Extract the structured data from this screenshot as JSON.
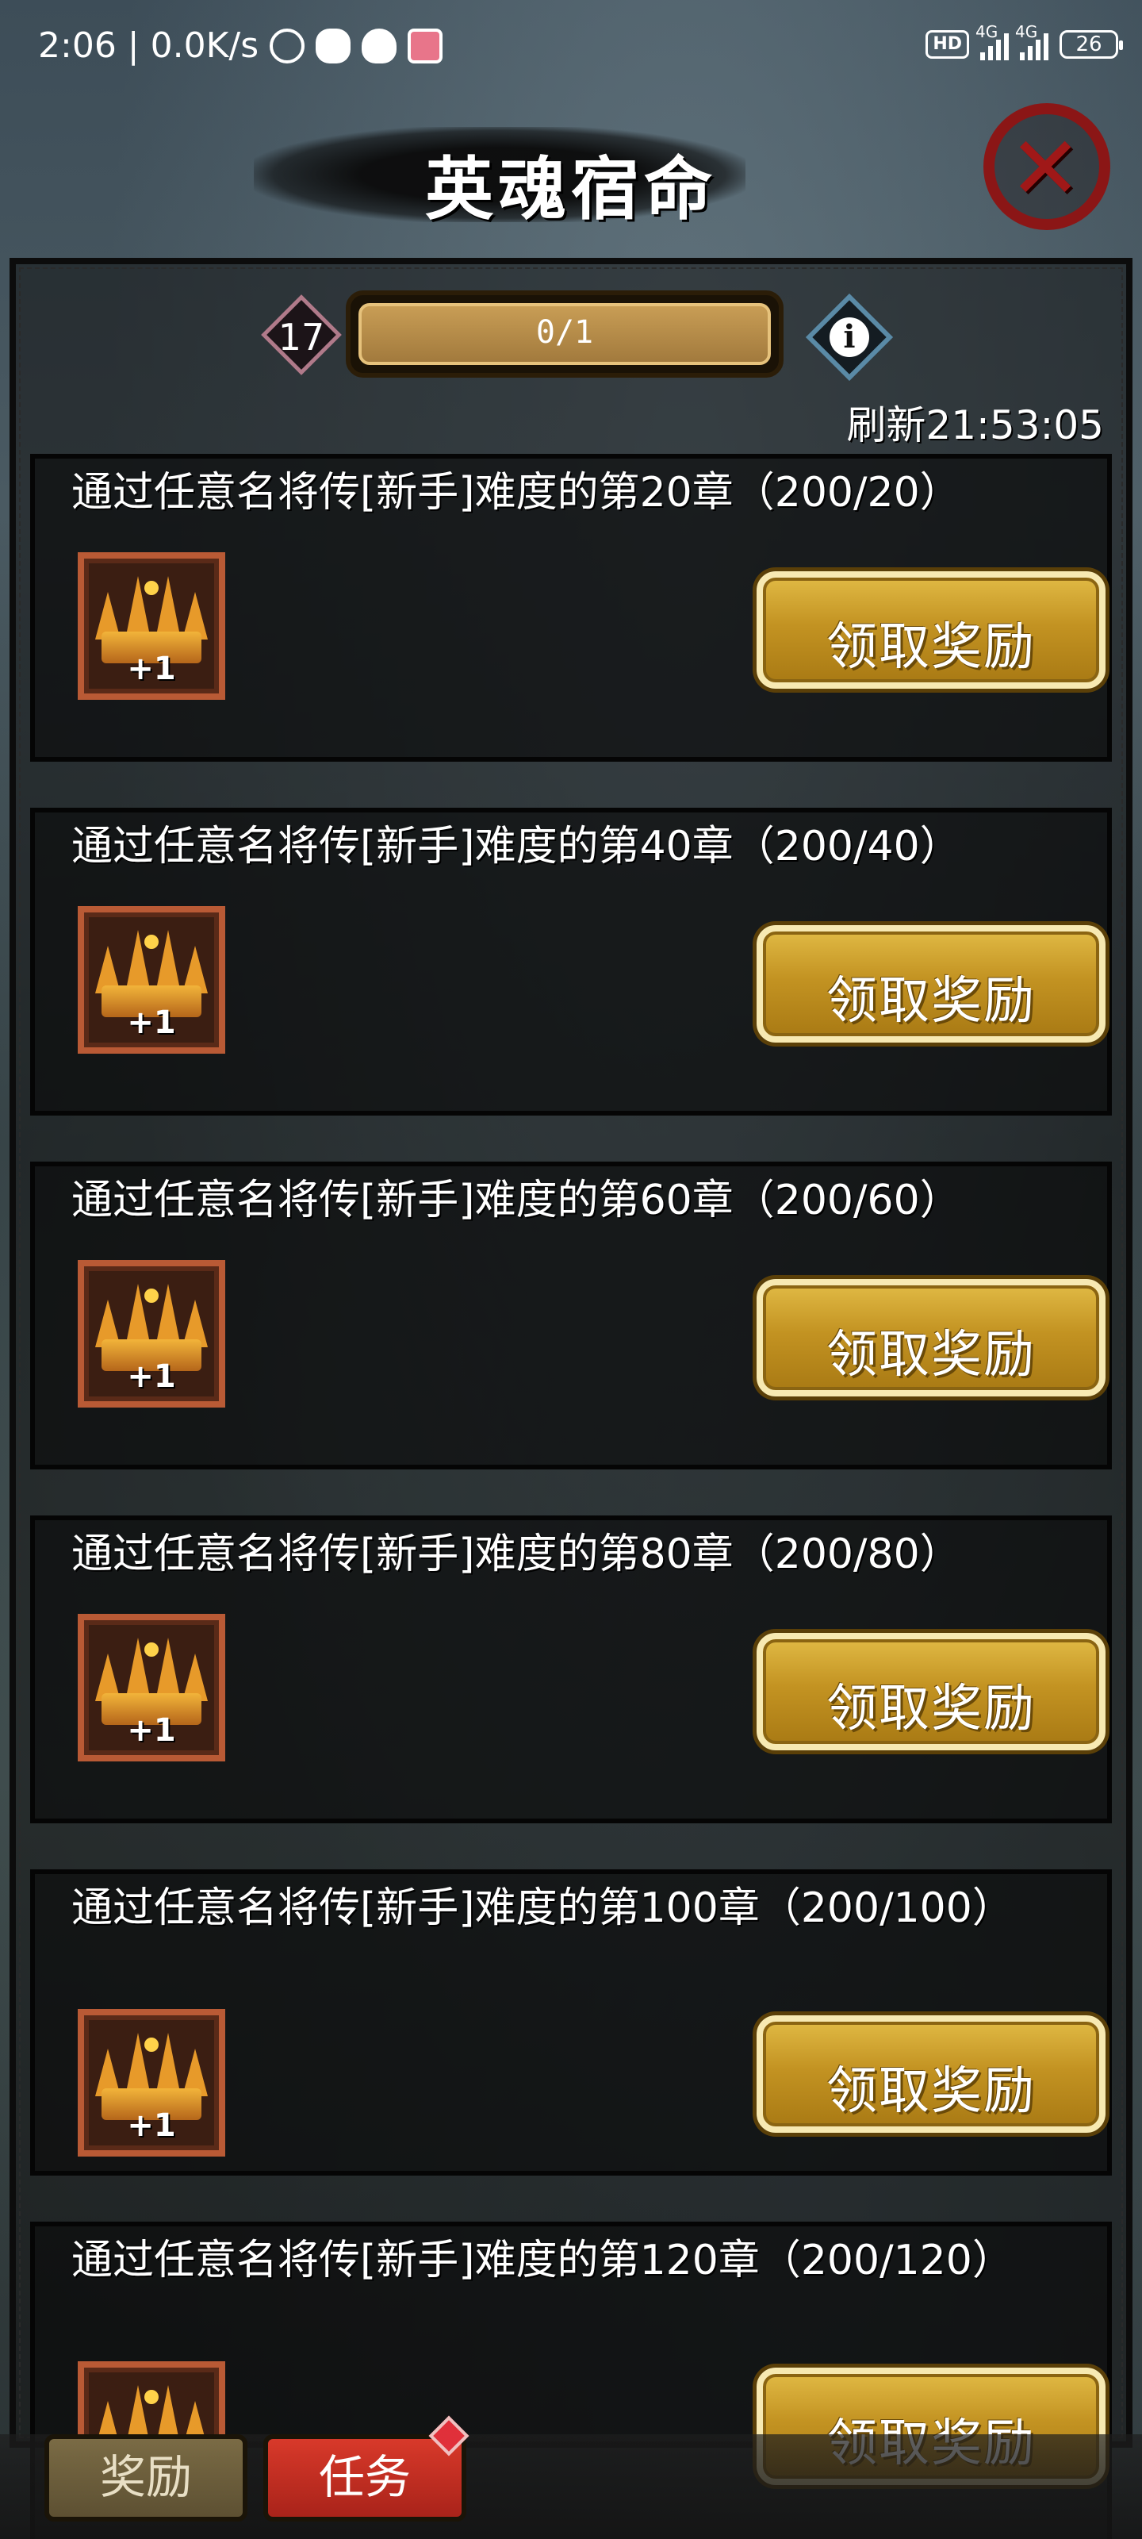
{
  "status_bar": {
    "time_speed": "2:06 | 0.0K/s",
    "network1": "4G",
    "network2": "4G",
    "hd": "HD",
    "battery": "26",
    "icons": [
      "alarm-icon",
      "wechat-icon",
      "qq-icon",
      "app-icon"
    ]
  },
  "header": {
    "title": "英魂宿命",
    "close_icon": "close-icon"
  },
  "progress": {
    "level": "17",
    "text": "0/1",
    "fraction": 1.0,
    "refresh": "刷新21:53:05",
    "info_icon": "info-icon"
  },
  "tasks": [
    {
      "desc": "通过任意名将传[新手]难度的第20章（200/20）",
      "reward_count": "+1",
      "button": "领取奖励"
    },
    {
      "desc": "通过任意名将传[新手]难度的第40章（200/40）",
      "reward_count": "+1",
      "button": "领取奖励"
    },
    {
      "desc": "通过任意名将传[新手]难度的第60章（200/60）",
      "reward_count": "+1",
      "button": "领取奖励"
    },
    {
      "desc": "通过任意名将传[新手]难度的第80章（200/80）",
      "reward_count": "+1",
      "button": "领取奖励"
    },
    {
      "desc": "通过任意名将传[新手]难度的第100章（200/100）",
      "reward_count": "+1",
      "button": "领取奖励"
    },
    {
      "desc": "通过任意名将传[新手]难度的第120章（200/120）",
      "reward_count": "",
      "button": "领取奖励"
    }
  ],
  "tabs": {
    "reward": "奖励",
    "task": "任务"
  }
}
